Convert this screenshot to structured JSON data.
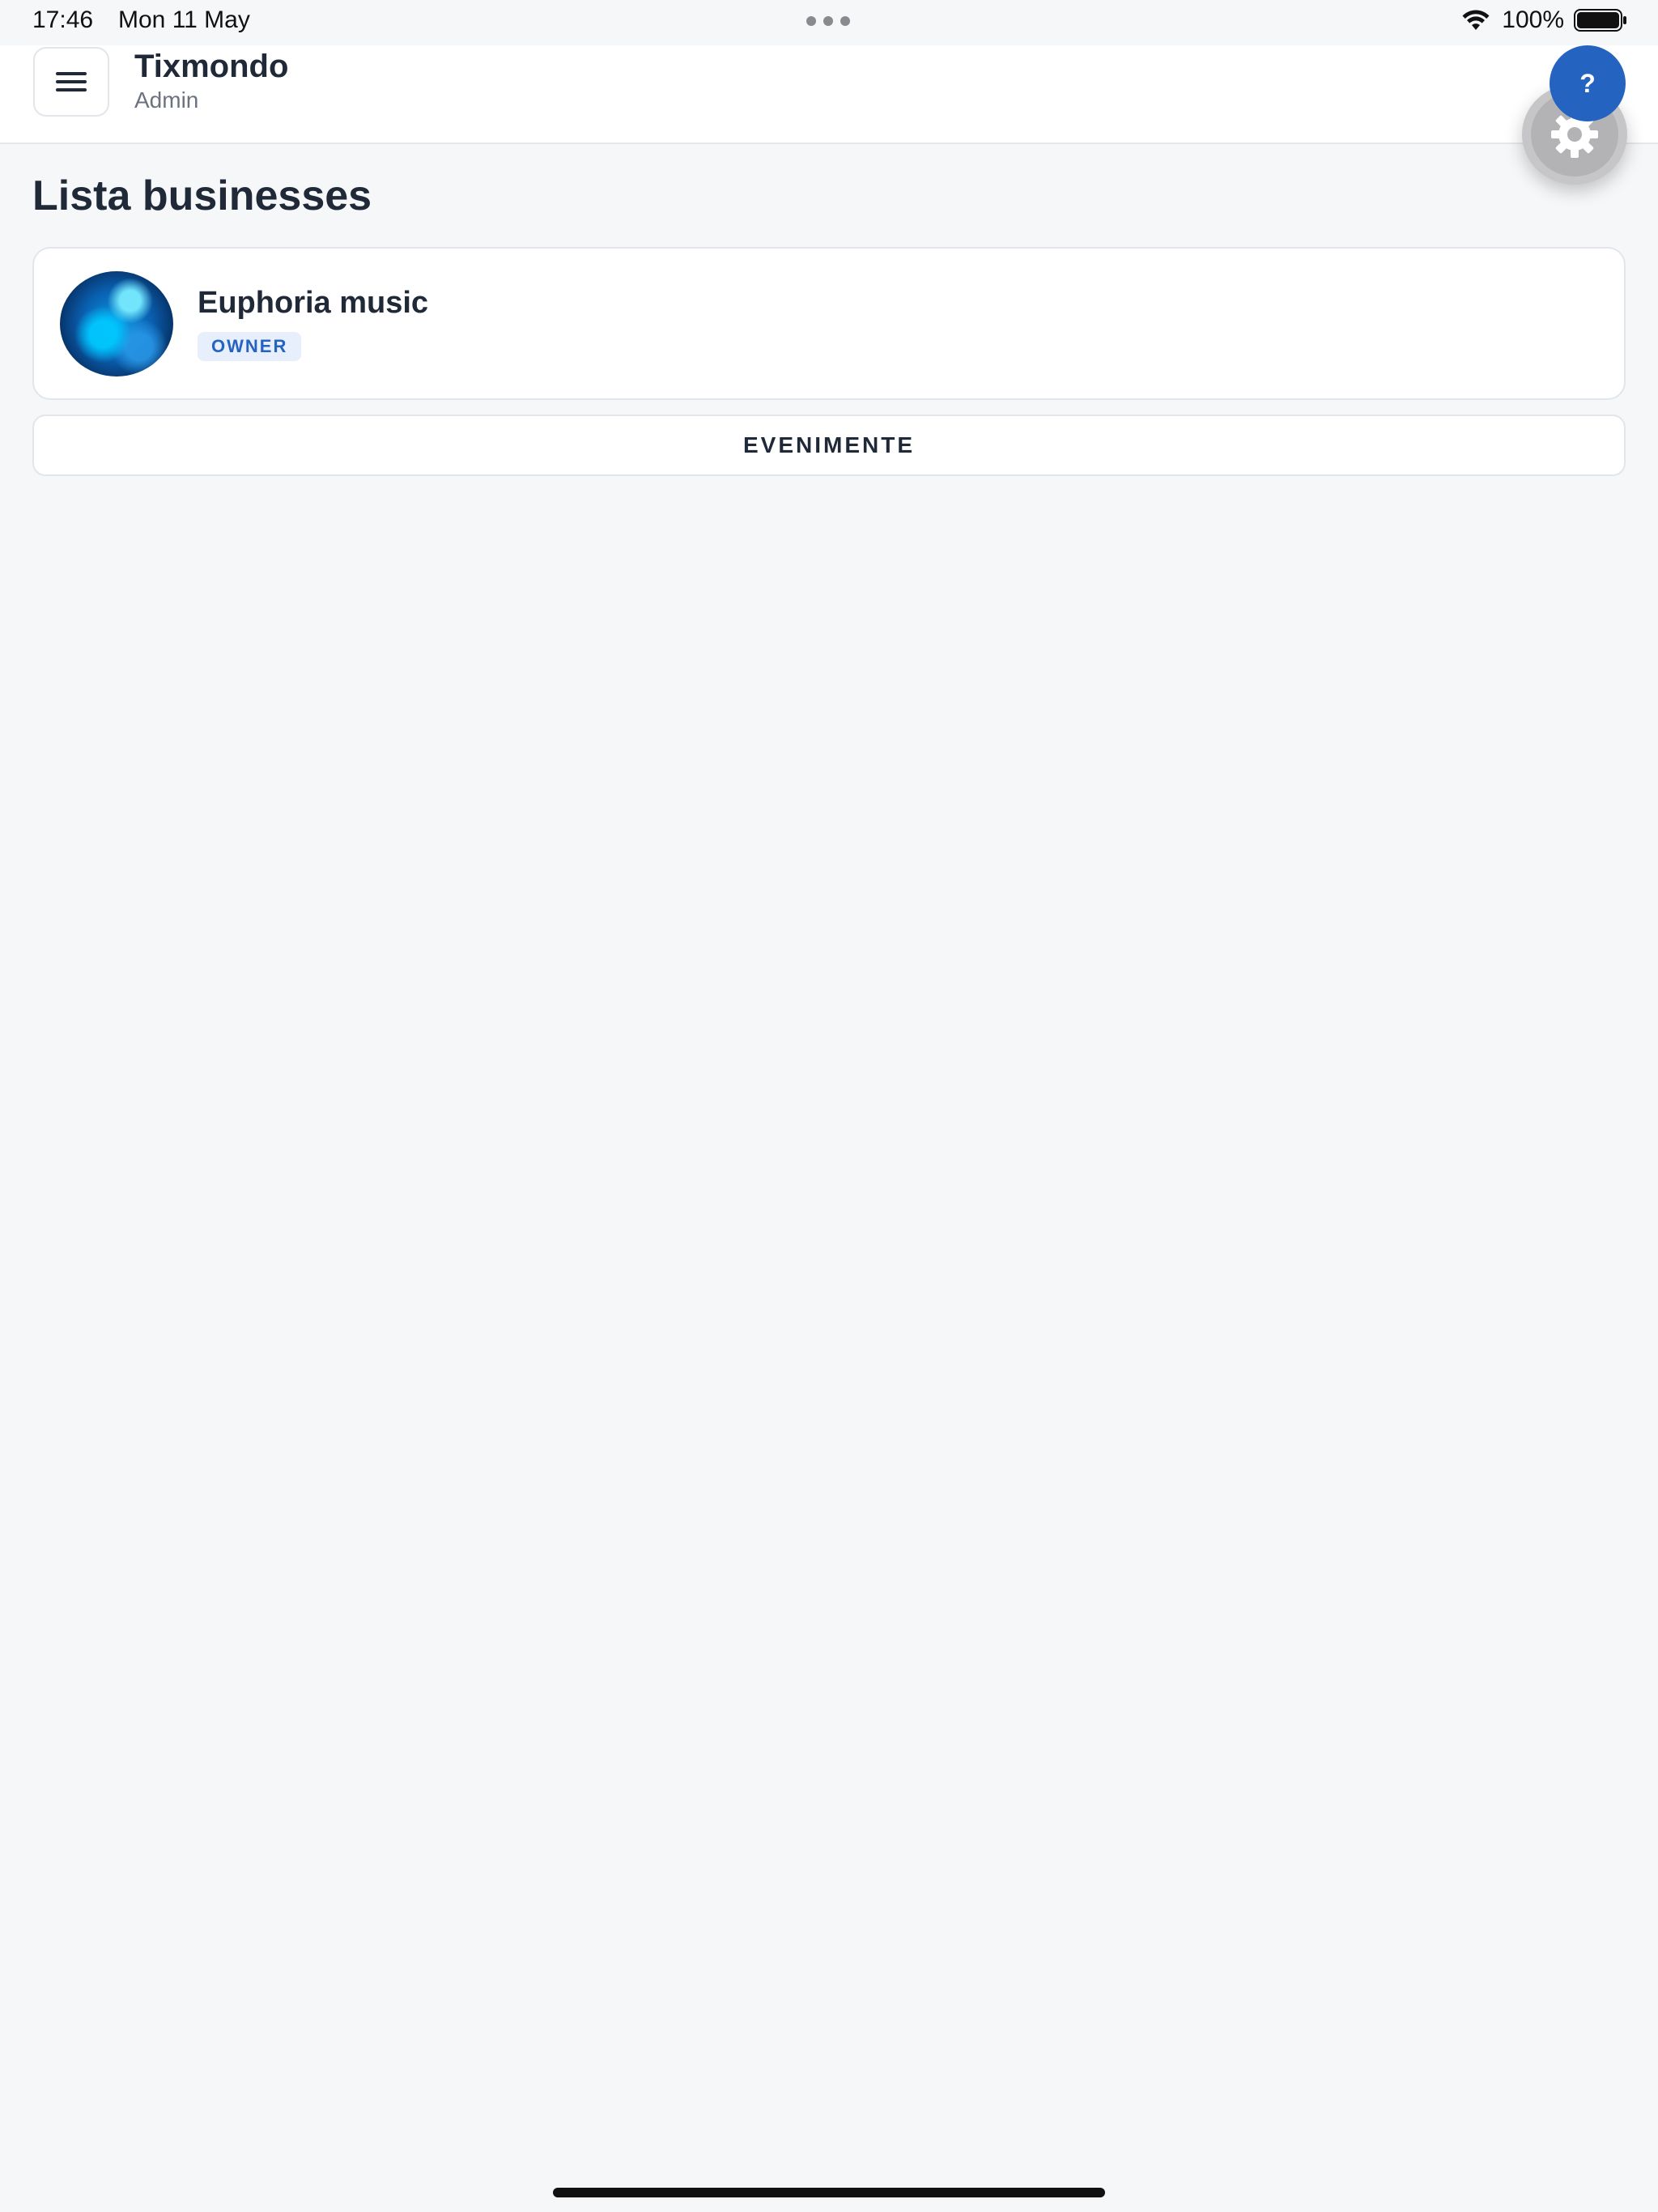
{
  "status_bar": {
    "time": "17:46",
    "date": "Mon 11 May",
    "battery_percent": "100%",
    "icons": [
      "wifi-icon",
      "battery-icon"
    ]
  },
  "header": {
    "menu_icon": "menu-icon",
    "title": "Tixmondo",
    "subtitle": "Admin"
  },
  "floating": {
    "help_label": "?",
    "settings_icon": "gear-icon"
  },
  "main": {
    "page_title": "Lista businesses",
    "businesses": [
      {
        "name": "Euphoria music",
        "role": "OWNER"
      }
    ],
    "events_button_label": "EVENIMENTE"
  },
  "colors": {
    "accent": "#2563c0",
    "background": "#f6f7f9",
    "text": "#1f2937",
    "muted": "#6b7280",
    "badge_bg": "#e6effb"
  }
}
